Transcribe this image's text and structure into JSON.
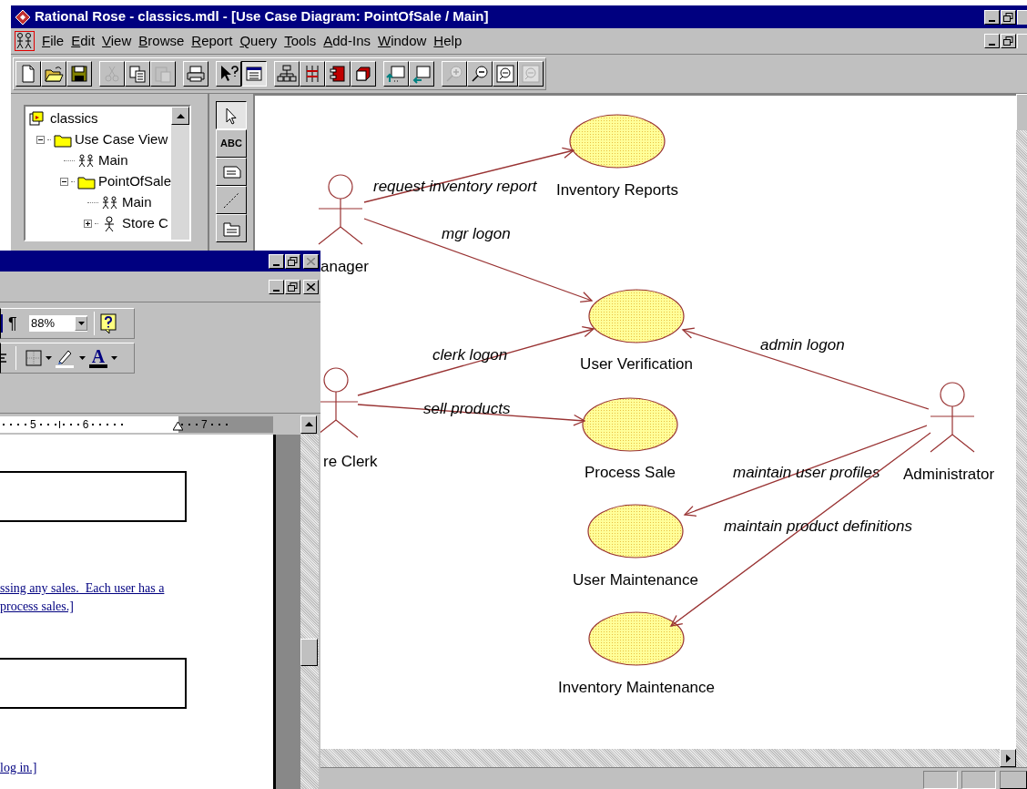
{
  "window": {
    "title": "Rational Rose - classics.mdl - [Use Case Diagram: PointOfSale / Main]"
  },
  "menu": [
    "File",
    "Edit",
    "View",
    "Browse",
    "Report",
    "Query",
    "Tools",
    "Add-Ins",
    "Window",
    "Help"
  ],
  "toolbar": [
    [
      {
        "kind": "new",
        "disabled": false,
        "pressed": false
      },
      {
        "kind": "open",
        "disabled": false,
        "pressed": false
      },
      {
        "kind": "save",
        "disabled": false,
        "pressed": false
      }
    ],
    [
      {
        "kind": "cut",
        "disabled": true,
        "pressed": false
      },
      {
        "kind": "copy",
        "disabled": false,
        "pressed": false
      },
      {
        "kind": "paste",
        "disabled": true,
        "pressed": false
      }
    ],
    [
      {
        "kind": "print",
        "disabled": false,
        "pressed": false
      }
    ],
    [
      {
        "kind": "help",
        "disabled": false,
        "pressed": false
      },
      {
        "kind": "documentation",
        "disabled": false,
        "pressed": true
      }
    ],
    [
      {
        "kind": "hierarchy",
        "disabled": false,
        "pressed": false
      },
      {
        "kind": "interaction",
        "disabled": false,
        "pressed": false
      },
      {
        "kind": "component",
        "disabled": false,
        "pressed": false
      },
      {
        "kind": "cube",
        "disabled": false,
        "pressed": false
      }
    ],
    [
      {
        "kind": "parent",
        "disabled": false,
        "pressed": false
      },
      {
        "kind": "previous",
        "disabled": false,
        "pressed": false
      }
    ],
    [
      {
        "kind": "zoom-in",
        "disabled": true,
        "pressed": false
      },
      {
        "kind": "zoom-out",
        "disabled": false,
        "pressed": false
      },
      {
        "kind": "fit",
        "disabled": false,
        "pressed": false
      },
      {
        "kind": "undo-fit",
        "disabled": true,
        "pressed": false
      }
    ]
  ],
  "browser_tree": [
    {
      "label": "classics",
      "kind": "model",
      "children": [
        {
          "label": "Use Case View",
          "kind": "folder",
          "expanded": true,
          "children": [
            {
              "label": "Main",
              "kind": "diagram"
            },
            {
              "label": "PointOfSale",
              "kind": "folder",
              "expanded": true,
              "children": [
                {
                  "label": "Main",
                  "kind": "diagram"
                },
                {
                  "label": "Store C",
                  "kind": "actor",
                  "expanded": false
                }
              ]
            }
          ]
        }
      ]
    }
  ],
  "toolbox": [
    {
      "kind": "pointer",
      "selected": true
    },
    {
      "kind": "text",
      "label": "ABC",
      "selected": false
    },
    {
      "kind": "note",
      "selected": false
    },
    {
      "kind": "anchor",
      "selected": false
    },
    {
      "kind": "package",
      "selected": false
    }
  ],
  "diagram": {
    "actors": [
      {
        "label": "anager"
      },
      {
        "label": "re Clerk"
      },
      {
        "label": "Administrator"
      }
    ],
    "use_cases": [
      {
        "label": "Inventory Reports"
      },
      {
        "label": "User Verification"
      },
      {
        "label": "Process Sale"
      },
      {
        "label": "User Maintenance"
      },
      {
        "label": "Inventory Maintenance"
      }
    ],
    "associations": [
      {
        "label": "request inventory report"
      },
      {
        "label": "mgr logon"
      },
      {
        "label": "clerk logon"
      },
      {
        "label": "sell products"
      },
      {
        "label": "admin logon"
      },
      {
        "label": "maintain user profiles"
      },
      {
        "label": "maintain product definitions"
      }
    ]
  },
  "word_window": {
    "toolbar_row_1": {
      "pilcrow": "¶",
      "zoom": "88%"
    },
    "toolbar_row_2": {
      "font_color_letter": "A"
    },
    "ruler": [
      "5",
      "6",
      "7"
    ],
    "document": {
      "paragraphs": [
        [
          "ssing any sales.  Each user has a",
          "process sales.]"
        ],
        [
          "log in.]"
        ]
      ]
    }
  }
}
